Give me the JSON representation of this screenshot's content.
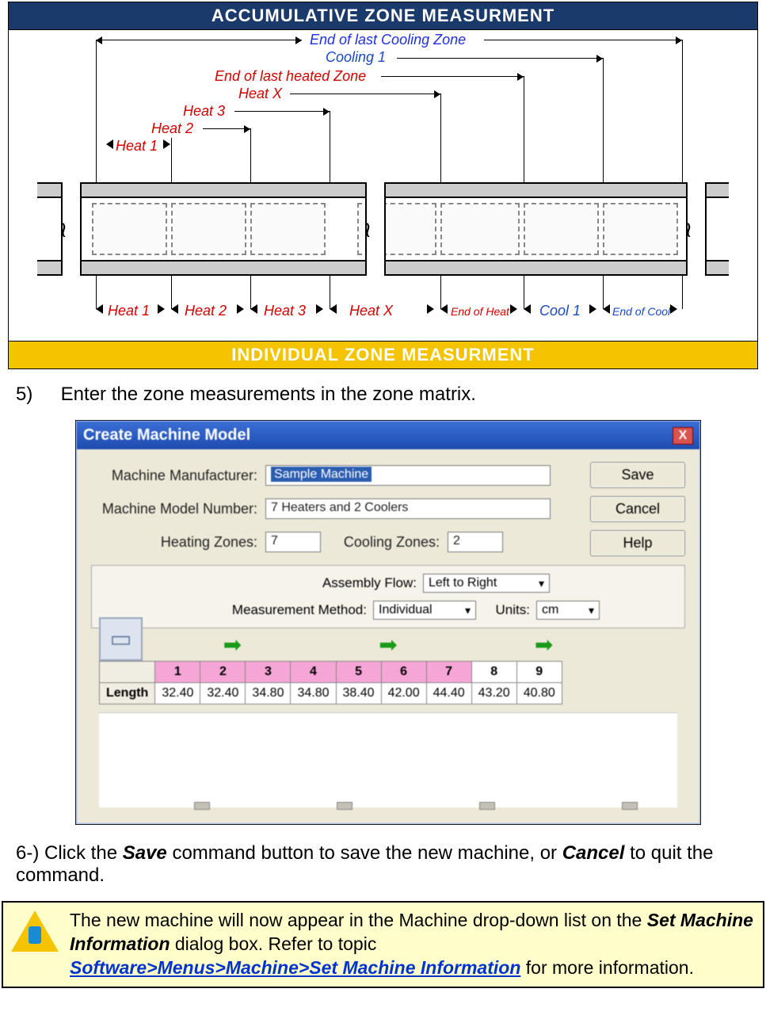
{
  "diagram": {
    "banner_top": "ACCUMULATIVE ZONE MEASURMENT",
    "banner_bottom": "INDIVIDUAL ZONE MEASURMENT",
    "top_labels": {
      "end_cool": "End of last Cooling Zone",
      "cooling1": "Cooling 1",
      "end_heat": "End of last heated Zone",
      "heatx": "Heat X",
      "heat3": "Heat 3",
      "heat2": "Heat 2",
      "heat1": "Heat 1"
    },
    "bottom_labels": {
      "heat1": "Heat 1",
      "heat2": "Heat 2",
      "heat3": "Heat 3",
      "heatx": "Heat X",
      "end_heat": "End of Heat",
      "cool1": "Cool 1",
      "end_cool": "End of Cool"
    }
  },
  "step5": {
    "num": "5)",
    "text": "Enter the zone measurements in the zone matrix."
  },
  "dialog": {
    "title": "Create Machine Model",
    "close": "X",
    "labels": {
      "manufacturer": "Machine Manufacturer:",
      "model": "Machine Model Number:",
      "heating": "Heating Zones:",
      "cooling": "Cooling Zones:",
      "flow": "Assembly Flow:",
      "method": "Measurement Method:",
      "units": "Units:",
      "length": "Length"
    },
    "values": {
      "manufacturer": "Sample Machine",
      "model": "7 Heaters and 2 Coolers",
      "heating": "7",
      "cooling": "2",
      "flow": "Left to Right",
      "method": "Individual",
      "units": "cm"
    },
    "buttons": {
      "save": "Save",
      "cancel": "Cancel",
      "help": "Help"
    },
    "zone_headers": [
      "1",
      "2",
      "3",
      "4",
      "5",
      "6",
      "7",
      "8",
      "9"
    ],
    "zone_lengths": [
      "32.40",
      "32.40",
      "34.80",
      "34.80",
      "38.40",
      "42.00",
      "44.40",
      "43.20",
      "40.80"
    ]
  },
  "step6": {
    "num": "6-)",
    "t1": "Click the ",
    "save": "Save",
    "t2": " command button to save the new machine, or ",
    "cancel": "Cancel",
    "t3": " to quit the command."
  },
  "note": {
    "t1": "The new machine will now appear in the Machine drop-down list on the ",
    "bold1": "Set Machine Information",
    "t2": " dialog box. Refer to topic ",
    "link": "Software>Menus>Machine>Set Machine Information",
    "t3": " for more information."
  }
}
